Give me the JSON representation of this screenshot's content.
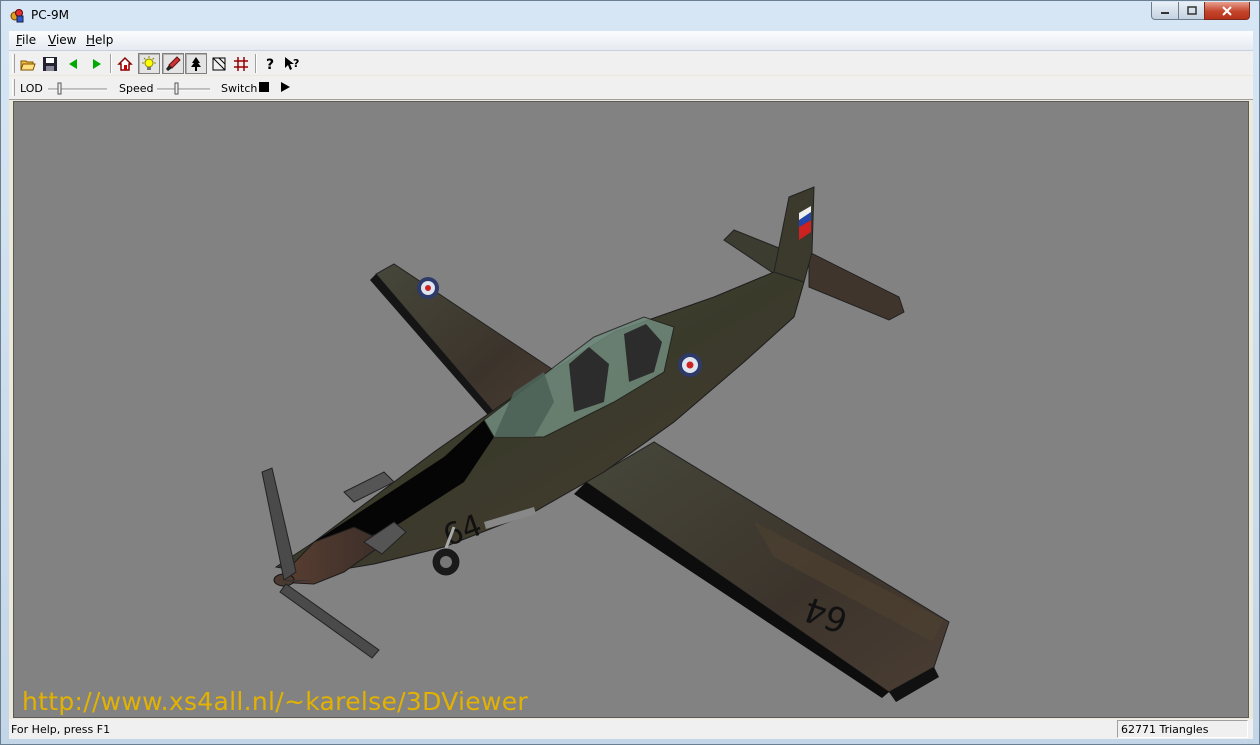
{
  "window": {
    "title": "PC-9M"
  },
  "menu": {
    "file": "File",
    "view": "View",
    "help": "Help"
  },
  "toolbar": {
    "buttons": [
      {
        "name": "open-icon"
      },
      {
        "name": "save-icon"
      },
      {
        "name": "previous-icon"
      },
      {
        "name": "next-icon"
      },
      {
        "name": "home-view-icon"
      },
      {
        "name": "light-icon"
      },
      {
        "name": "paint-icon"
      },
      {
        "name": "tree-icon"
      },
      {
        "name": "wireframe-icon"
      },
      {
        "name": "grid-icon"
      },
      {
        "name": "help-icon"
      },
      {
        "name": "context-help-icon"
      }
    ]
  },
  "toolbar2": {
    "lod_label": "LOD",
    "speed_label": "Speed",
    "switch_label": "Switch"
  },
  "viewport": {
    "url_text": "http://www.xs4all.nl/~karelse/3DViewer",
    "model": "PC-9M aircraft",
    "tail_number": "64"
  },
  "status": {
    "help_text": "For Help, press F1",
    "triangles": "62771 Triangles"
  },
  "colors": {
    "viewport_bg": "#828282",
    "url_text": "#e3b200",
    "camouflage": "#3b3a2c"
  }
}
